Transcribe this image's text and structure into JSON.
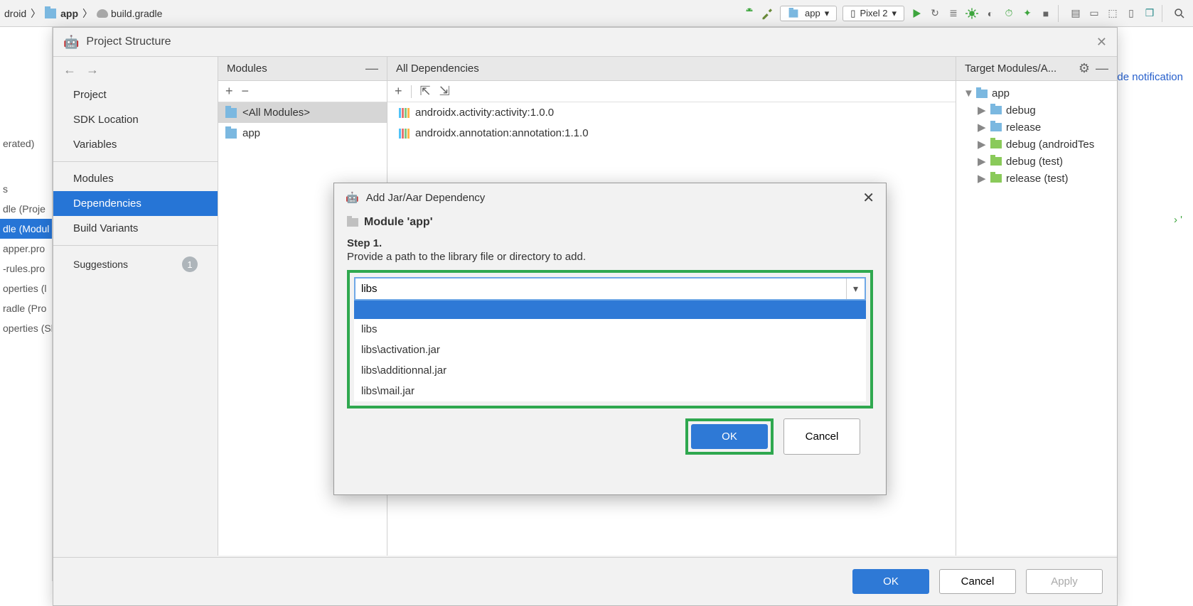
{
  "breadcrumb": {
    "root": "droid",
    "app": "app",
    "file": "build.gradle"
  },
  "toolbar": {
    "module_combo": "app",
    "device_combo": "Pixel 2"
  },
  "hide_link": "Hide notification",
  "left_cut": [
    "",
    "",
    "erated)",
    "",
    "s",
    "dle (Proje",
    "dle (Modul",
    "apper.pro",
    "-rules.pro",
    "operties (l",
    "radle (Pro",
    "operties (Sl"
  ],
  "ps": {
    "title": "Project Structure",
    "nav": {
      "items": [
        "Project",
        "SDK Location",
        "Variables",
        "Modules",
        "Dependencies",
        "Build Variants"
      ],
      "selected": 4,
      "suggestions_label": "Suggestions",
      "suggestions_badge": "1"
    },
    "modules": {
      "header": "Modules",
      "items": [
        "<All Modules>",
        "app"
      ],
      "selected": 0
    },
    "deps": {
      "header": "All Dependencies",
      "items": [
        "androidx.activity:activity:1.0.0",
        "androidx.annotation:annotation:1.1.0"
      ]
    },
    "target": {
      "header": "Target Modules/A...",
      "root": "app",
      "children": [
        "debug",
        "release",
        "debug (androidTes",
        "debug (test)",
        "release (test)"
      ]
    },
    "footer": {
      "ok": "OK",
      "cancel": "Cancel",
      "apply": "Apply"
    }
  },
  "dlg": {
    "title": "Add Jar/Aar Dependency",
    "module_label": "Module 'app'",
    "step_label": "Step 1.",
    "instruction": "Provide a path to the library file or directory to add.",
    "input_value": "libs",
    "options": [
      "",
      "libs",
      "libs\\activation.jar",
      "libs\\additionnal.jar",
      "libs\\mail.jar"
    ],
    "ok": "OK",
    "cancel": "Cancel"
  },
  "right_marker": "› '"
}
